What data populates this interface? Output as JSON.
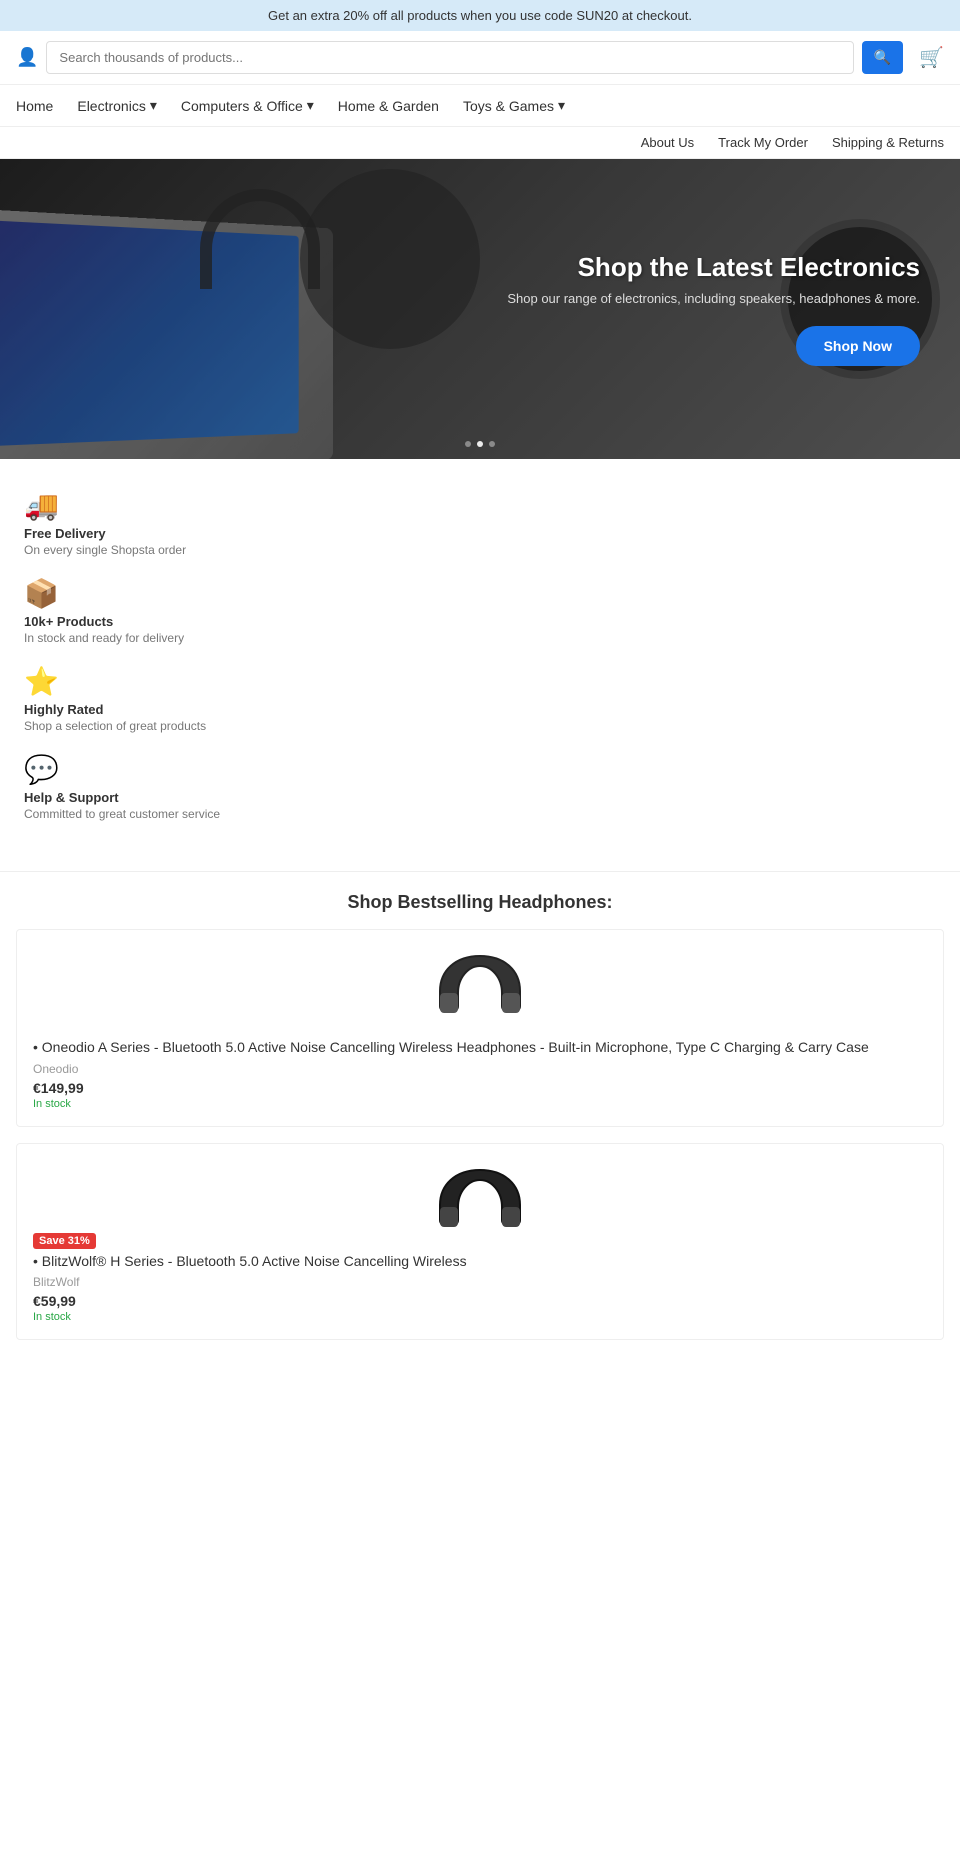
{
  "top_banner": {
    "text": "Get an extra 20% off all products when you use code SUN20 at checkout."
  },
  "search": {
    "placeholder": "Search thousands of products...",
    "button_label": "🔍"
  },
  "nav": {
    "main_items": [
      {
        "label": "Home",
        "dropdown": false
      },
      {
        "label": "Electronics",
        "dropdown": true
      },
      {
        "label": "Computers & Office",
        "dropdown": true
      },
      {
        "label": "Home & Garden",
        "dropdown": false
      },
      {
        "label": "Toys & Games",
        "dropdown": true
      }
    ],
    "secondary_items": [
      {
        "label": "About Us"
      },
      {
        "label": "Track My Order"
      },
      {
        "label": "Shipping & Returns"
      }
    ]
  },
  "hero": {
    "title": "Shop the Latest Electronics",
    "subtitle": "Shop our range of electronics, including speakers, headphones & more.",
    "button_label": "Shop Now",
    "dots": [
      {
        "active": false
      },
      {
        "active": true
      },
      {
        "active": false
      }
    ]
  },
  "features": [
    {
      "icon": "🚚",
      "title": "Free Delivery",
      "description": "On every single Shopsta order"
    },
    {
      "icon": "📦",
      "title": "10k+ Products",
      "description": "In stock and ready for delivery"
    },
    {
      "icon": "⭐",
      "title": "Highly Rated",
      "description": "Shop a selection of great products"
    },
    {
      "icon": "💬",
      "title": "Help & Support",
      "description": "Committed to great customer service"
    }
  ],
  "bestsellers": {
    "heading": "Shop Bestselling Headphones:",
    "products": [
      {
        "name": "Oneodio A Series - Bluetooth 5.0 Active Noise Cancelling Wireless Headphones - Built-in Microphone, Type C Charging & Carry Case",
        "brand": "Oneodio",
        "price": "€149,99",
        "stock": "In stock",
        "save_badge": null
      },
      {
        "name": "BlitzWolf® H Series - Bluetooth 5.0 Active Noise Cancelling Wireless",
        "brand": "BlitzWolf",
        "price": "€59,99",
        "stock": "In stock",
        "save_badge": "Save 31%"
      }
    ]
  }
}
